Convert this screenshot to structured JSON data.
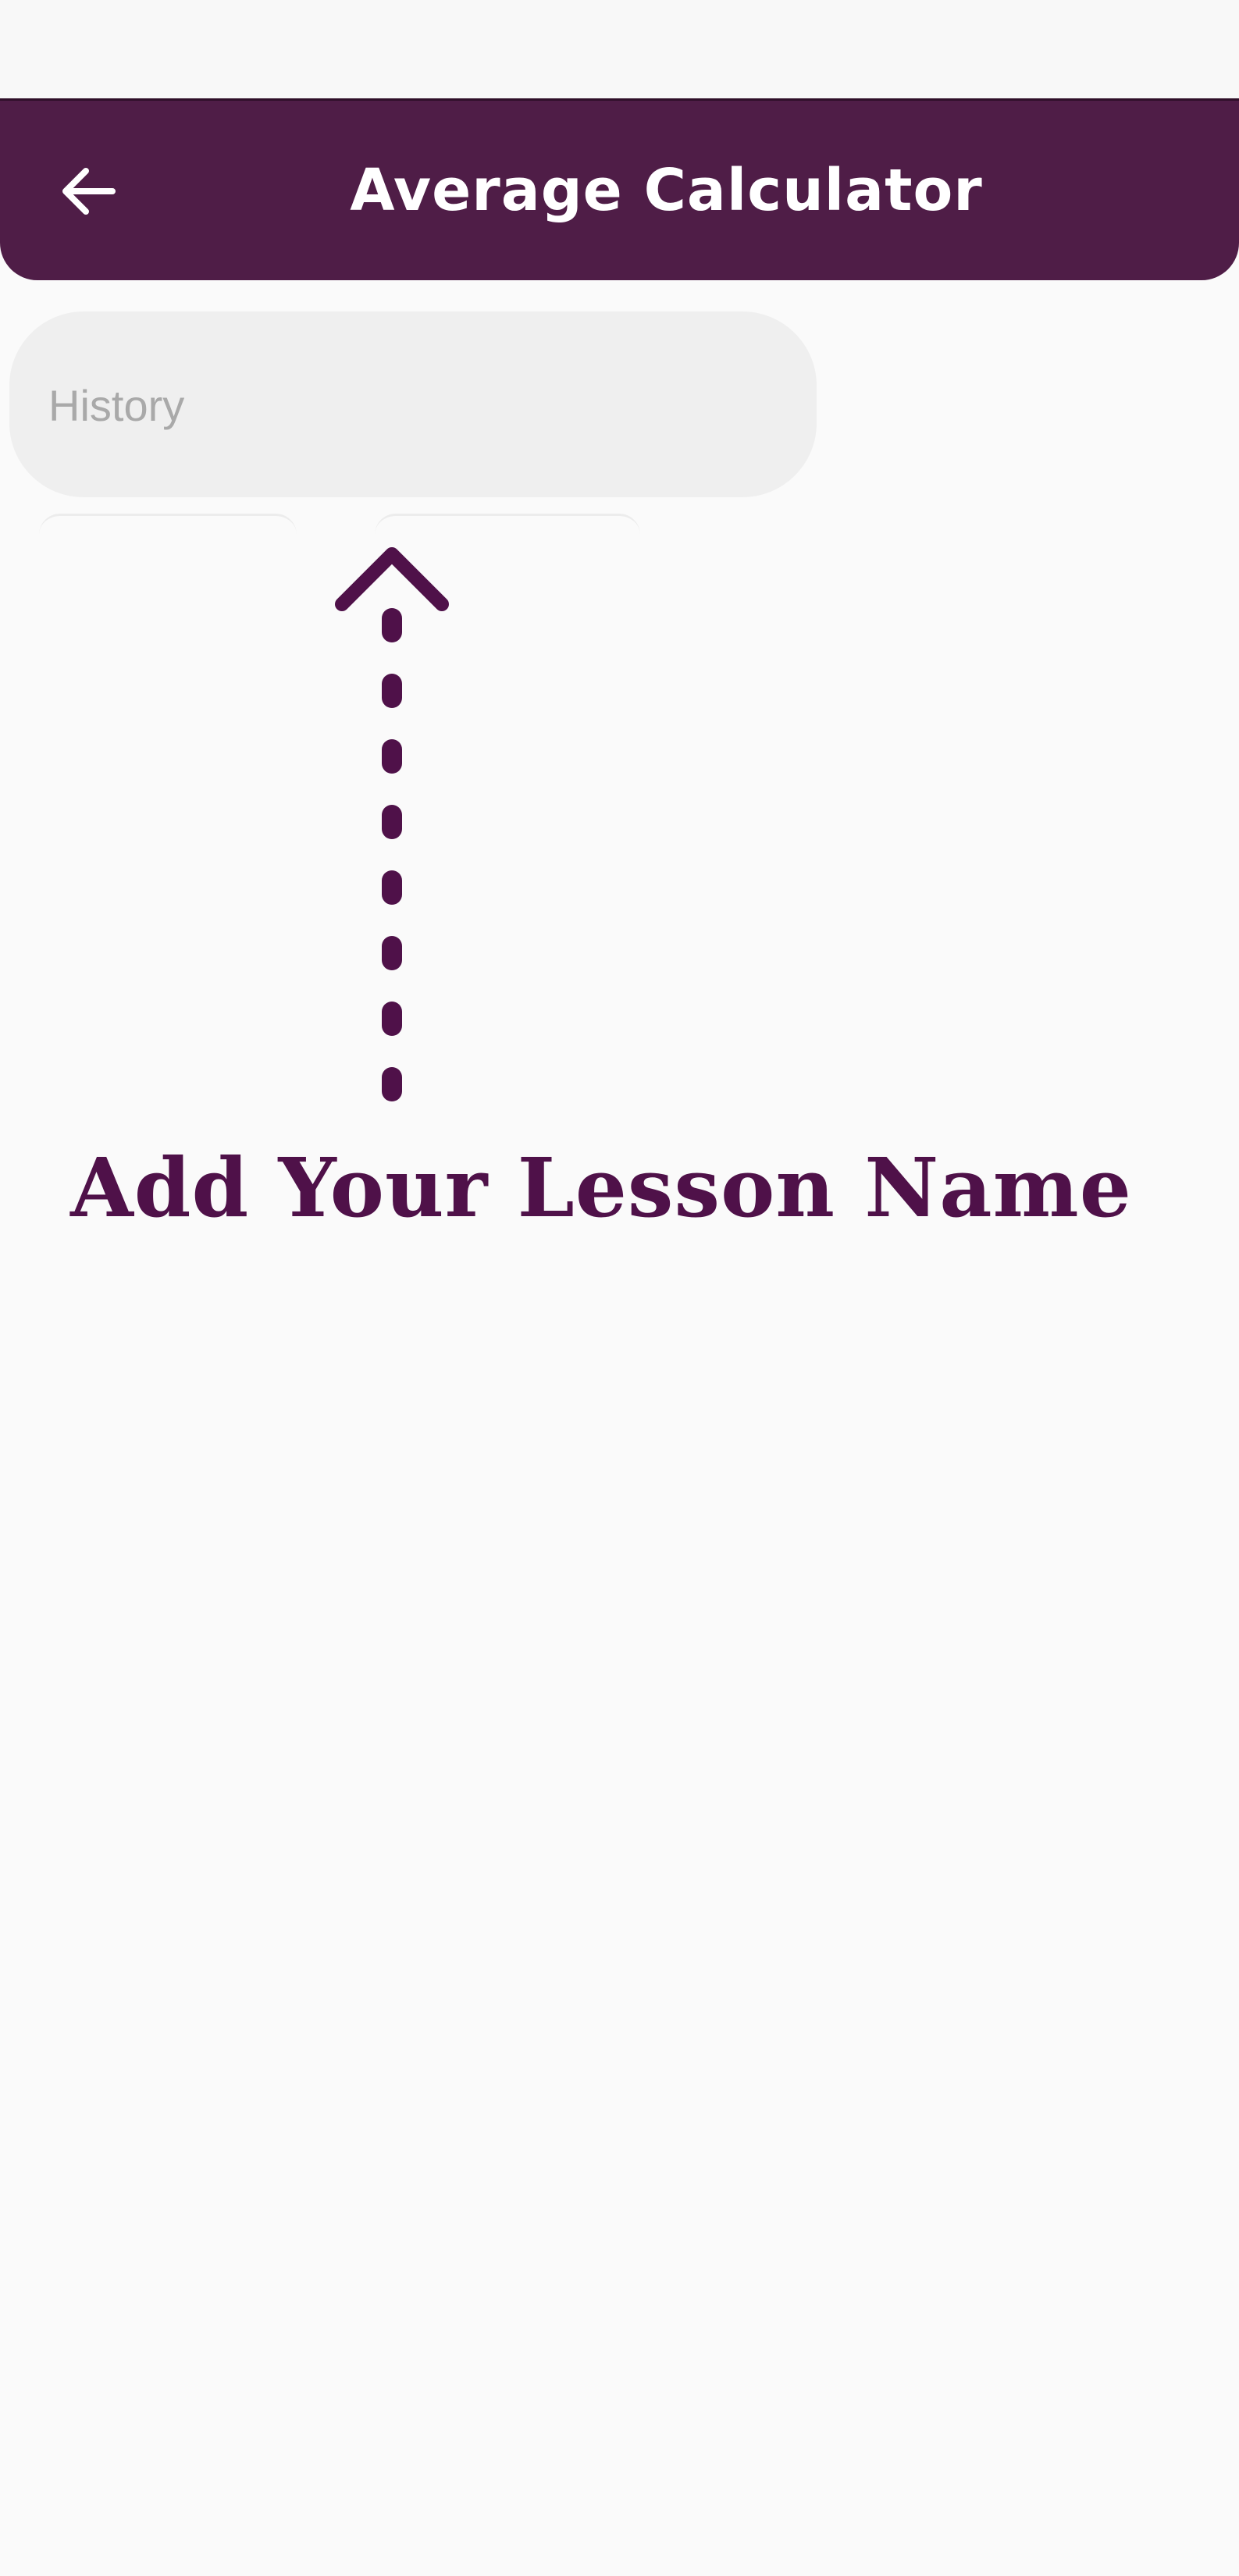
{
  "app_bar": {
    "title": "Average Calculator",
    "back_icon": "arrow-left-icon",
    "color": "#4f1d47"
  },
  "lesson_input": {
    "value": "",
    "placeholder": "History"
  },
  "tutorial": {
    "text": "Add Your Lesson Name",
    "arrow_icon": "dashed-arrow-up-icon",
    "color": "#4f1149"
  }
}
